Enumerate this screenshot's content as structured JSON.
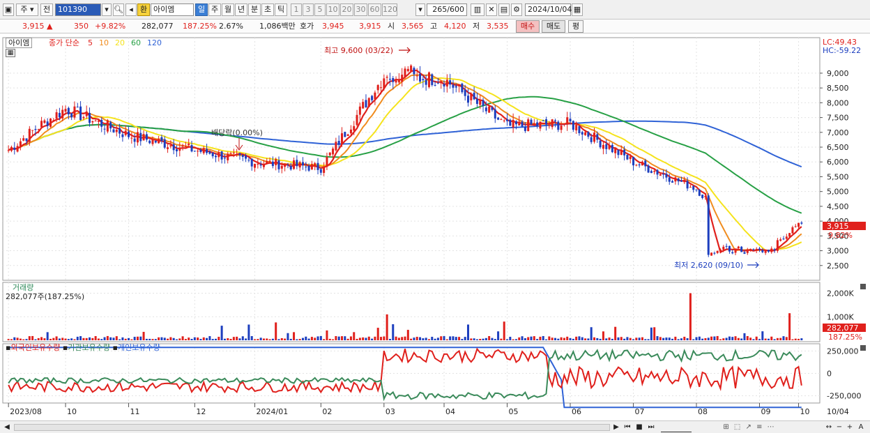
{
  "toolbar": {
    "period_label": "주",
    "market_label": "전",
    "code": "101390",
    "badge": "환",
    "stock_name": "아이엠",
    "periods": [
      "일",
      "주",
      "월",
      "년",
      "분",
      "초",
      "틱"
    ],
    "active_period": "일",
    "ranges": [
      "1",
      "3",
      "5",
      "10",
      "20",
      "30",
      "60",
      "120"
    ],
    "count": "265",
    "count_total": "/600",
    "date": "2024/10/04"
  },
  "quote": {
    "price": "3,915",
    "change": "350",
    "change_pct": "+9.82%",
    "volume": "282,077",
    "volume_ratio": "187.25%",
    "turnover_pct": "2.67%",
    "amount": "1,086백만",
    "ask_label": "호가",
    "ask": "3,945",
    "bid": "3,915",
    "open_label": "시",
    "open": "3,565",
    "high_label": "고",
    "high": "4,120",
    "low_label": "저",
    "low": "3,535",
    "buy_label": "매수",
    "sell_label": "매도",
    "eval_label": "평"
  },
  "price_pane": {
    "legend_name": "아이엠",
    "legend_series": "종가 단순",
    "ma_periods": [
      "5",
      "10",
      "20",
      "60",
      "120"
    ],
    "max_label": "최고 9,600 (03/22)",
    "min_label": "최저 2,620 (09/10)",
    "dividend_label": "배당락(0.00%)",
    "lc": "LC:49.43",
    "hc": "HC:-59.22",
    "current_price_tag": "3,915",
    "current_pct_tag": "9.82%",
    "y_ticks": [
      "9,000",
      "8,500",
      "8,000",
      "7,500",
      "7,000",
      "6,500",
      "6,000",
      "5,500",
      "5,000",
      "4,500",
      "4,000",
      "3,500",
      "3,000",
      "2,500"
    ]
  },
  "volume_pane": {
    "title": "거래량",
    "value_label": "282,077주(187.25%)",
    "y_ticks": [
      "2,000K",
      "1,000K"
    ],
    "tag_value": "282,077",
    "tag_pct": "187.25%"
  },
  "holding_pane": {
    "series": [
      "외국인보유수량",
      "기관보유수량",
      "개인보유수량"
    ],
    "y_ticks": [
      "250,000",
      "0",
      "-250,000"
    ]
  },
  "x_axis": {
    "labels": [
      "2023/08",
      "10",
      "11",
      "12",
      "2024/01",
      "02",
      "03",
      "04",
      "05",
      "06",
      "07",
      "08",
      "09",
      "10"
    ],
    "end_label": "10/04"
  },
  "colors": {
    "up": "#e0201c",
    "down": "#1d3fbf",
    "ma5": "#e0201c",
    "ma10": "#f08c1e",
    "ma20": "#f5e31c",
    "ma60": "#27a045",
    "ma120": "#2f62d6",
    "foreign": "#e0201c",
    "institution": "#3a8a5a",
    "individual": "#2f62d6"
  },
  "chart_data": {
    "type": "candlestick",
    "price_range": [
      2500,
      9600
    ],
    "high": {
      "value": 9600,
      "date": "03/22"
    },
    "low": {
      "value": 2620,
      "date": "09/10"
    },
    "close_series_by_month": {
      "x": [
        "2023/08",
        "09",
        "10",
        "11",
        "12",
        "2024/01",
        "02",
        "03",
        "04",
        "05",
        "06",
        "07",
        "08",
        "09",
        "10"
      ],
      "close": [
        6400,
        7200,
        7800,
        6900,
        6400,
        6000,
        5800,
        8900,
        8800,
        7200,
        7300,
        6000,
        5100,
        2900,
        3915
      ]
    },
    "volume_range_k": [
      0,
      2000
    ],
    "holding_range": [
      -250000,
      250000
    ]
  }
}
